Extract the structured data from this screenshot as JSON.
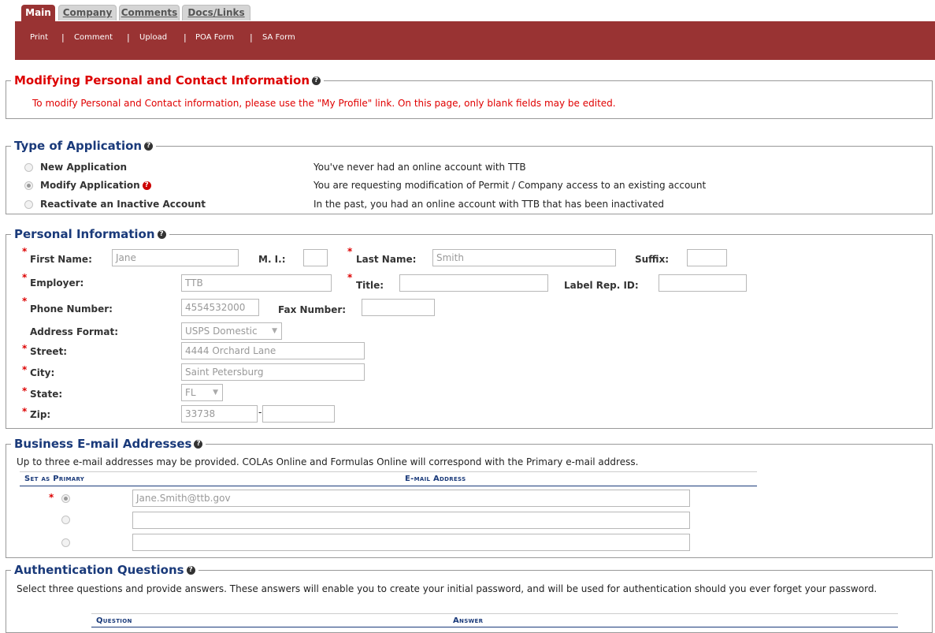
{
  "tabs": [
    "Main",
    "Company",
    "Comments",
    "Docs/Links"
  ],
  "sublinks": [
    "Print",
    "Comment",
    "Upload",
    "POA Form",
    "SA Form"
  ],
  "modify_section": {
    "title": "Modifying Personal and Contact Information",
    "message": "To modify Personal and Contact information, please use the \"My Profile\" link. On this page, only blank fields may be edited."
  },
  "app_type": {
    "title": "Type of Application",
    "options": [
      {
        "label": "New Application",
        "desc": "You've never had an online account with TTB"
      },
      {
        "label": "Modify Application",
        "desc": "You are requesting modification of Permit / Company access to an existing account"
      },
      {
        "label": "Reactivate an Inactive Account",
        "desc": "In the past, you had an online account with TTB that has been inactivated"
      }
    ]
  },
  "personal": {
    "title": "Personal Information",
    "first_name_label": "First Name:",
    "first_name": "Jane",
    "mi_label": "M. I.:",
    "mi": "",
    "last_name_label": "Last Name:",
    "last_name": "Smith",
    "suffix_label": "Suffix:",
    "suffix": "",
    "employer_label": "Employer:",
    "employer": "TTB",
    "title_label": "Title:",
    "title_val": "",
    "label_rep_label": "Label Rep. ID:",
    "label_rep": "",
    "phone_label": "Phone Number:",
    "phone": "4554532000",
    "fax_label": "Fax Number:",
    "fax": "",
    "address_format_label": "Address Format:",
    "address_format": "USPS Domestic",
    "street_label": "Street:",
    "street": "4444 Orchard Lane",
    "city_label": "City:",
    "city": "Saint Petersburg",
    "state_label": "State:",
    "state": "FL",
    "zip_label": "Zip:",
    "zip": "33738",
    "zip_dash": "-",
    "zip4": "",
    "required_mark": "*"
  },
  "emails": {
    "title": "Business E-mail Addresses",
    "intro": "Up to three e-mail addresses may be provided. COLAs Online and Formulas Online will correspond with the Primary e-mail address.",
    "col_primary": "Set as Primary",
    "col_address": "E-mail Address",
    "rows": [
      "Jane.Smith@ttb.gov",
      "",
      ""
    ]
  },
  "auth": {
    "title": "Authentication Questions",
    "intro": "Select three questions and provide answers. These answers will enable you to create your initial password, and will be used for authentication should you ever forget your password.",
    "col_question": "Question",
    "col_answer": "Answer"
  },
  "icons": {
    "help": "help-circle-icon"
  }
}
